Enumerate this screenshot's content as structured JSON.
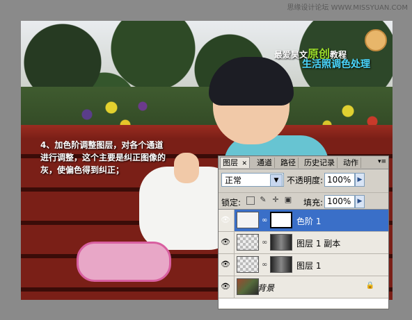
{
  "watermark": "思缘设计论坛 WWW.MISSYUAN.COM",
  "logo": {
    "prefix": "最爱昊文",
    "big": "原创",
    "suffix": "教程",
    "line2": "生活照调色处理"
  },
  "instruction": "4、加色阶调整图层，对各个通道进行调整，这个主要是纠正图像的灰，使偏色得到纠正；",
  "panel": {
    "tabs": [
      {
        "label": "图层",
        "close": "✕"
      },
      {
        "label": "通道"
      },
      {
        "label": "路径"
      },
      {
        "label": "历史记录"
      },
      {
        "label": "动作"
      }
    ],
    "menu": "▾≡",
    "blend_mode": "正常",
    "opacity_label": "不透明度:",
    "opacity_value": "100%",
    "lock_label": "锁定:",
    "fill_label": "填充:",
    "fill_value": "100%",
    "layers": [
      {
        "name": "色阶 1",
        "selected": true
      },
      {
        "name": "图层 1 副本",
        "selected": false
      },
      {
        "name": "图层 1",
        "selected": false
      },
      {
        "name": "背景",
        "selected": false
      }
    ]
  },
  "colors": {
    "selected_layer": "#3a6fc8",
    "panel_bg": "#d4d0c8",
    "instruction_text": "#ffffff"
  }
}
